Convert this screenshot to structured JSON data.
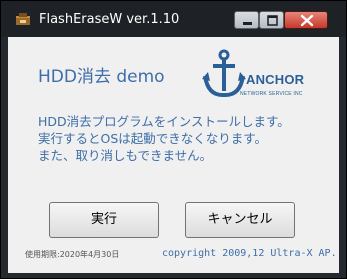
{
  "window": {
    "title": "FlashEraseW ver.1.10",
    "icons": {
      "app": "application-icon",
      "minimize": "minimize-icon",
      "maximize": "maximize-icon",
      "close": "close-icon"
    }
  },
  "main": {
    "heading": "HDD消去 demo",
    "logo": {
      "name": "ANCHOR",
      "subtitle": "NETWORK SERVICE INC",
      "icon": "anchor-logo-icon"
    },
    "message_lines": [
      "HDD消去プログラムをインストールします。",
      "実行するとOSは起動できなくなります。",
      "また、取り消しもできません。"
    ],
    "buttons": {
      "run_label": "実行",
      "cancel_label": "キャンセル"
    },
    "footer": {
      "expiry": "使用期限:2020年4月30日",
      "copyright": "copyright 2009,12 Ultra-X AP."
    }
  },
  "colors": {
    "accent_text": "#3e6ea8",
    "logo_blue": "#2b5f98",
    "client_bg": "#f0f0f0",
    "close_button": "#c7382b"
  }
}
